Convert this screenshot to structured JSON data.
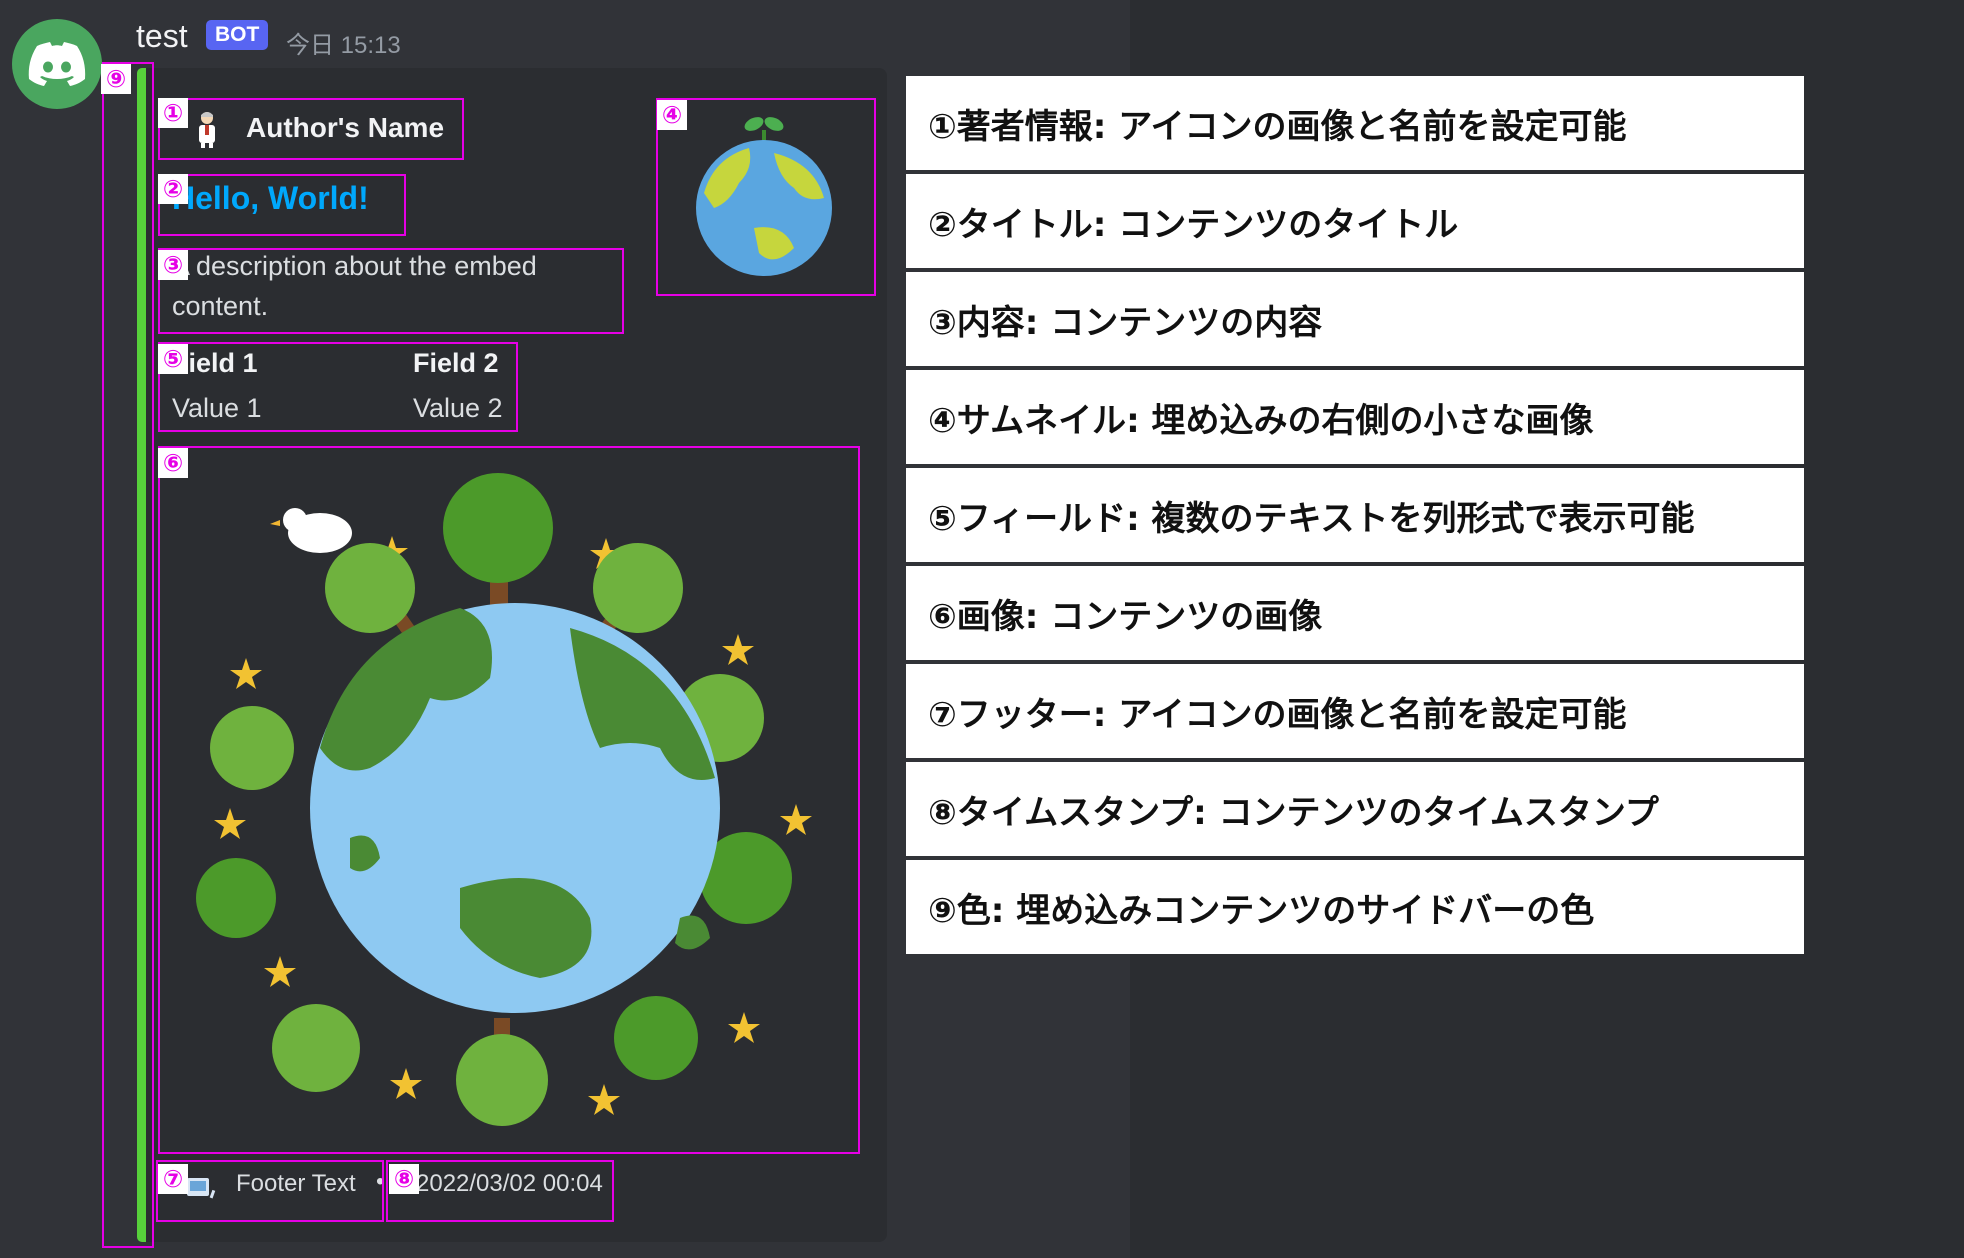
{
  "message": {
    "username": "test",
    "bot_badge": "BOT",
    "timestamp": "今日 15:13"
  },
  "embed": {
    "color": "#57d13b",
    "author": {
      "name": "Author's Name",
      "icon": "person-icon"
    },
    "title": "Hello, World!",
    "title_color": "#00a8fc",
    "description": "A description about the embed content.",
    "fields": [
      {
        "name": "Field 1",
        "value": "Value 1"
      },
      {
        "name": "Field 2",
        "value": "Value 2"
      }
    ],
    "thumbnail": "earth-sprout-icon",
    "image": "earth-with-trees-illustration",
    "footer": {
      "text": "Footer Text",
      "icon": "footer-icon",
      "separator": "•"
    },
    "footer_timestamp": "2022/03/02 00:04"
  },
  "markers": [
    "①",
    "②",
    "③",
    "④",
    "⑤",
    "⑥",
    "⑦",
    "⑧",
    "⑨"
  ],
  "legend": [
    "①著者情報: アイコンの画像と名前を設定可能",
    "②タイトル: コンテンツのタイトル",
    "③内容: コンテンツの内容",
    "④サムネイル: 埋め込みの右側の小さな画像",
    "⑤フィールド: 複数のテキストを列形式で表示可能",
    "⑥画像: コンテンツの画像",
    "⑦フッター: アイコンの画像と名前を設定可能",
    "⑧タイムスタンプ: コンテンツのタイムスタンプ",
    "⑨色: 埋め込みコンテンツのサイドバーの色"
  ]
}
